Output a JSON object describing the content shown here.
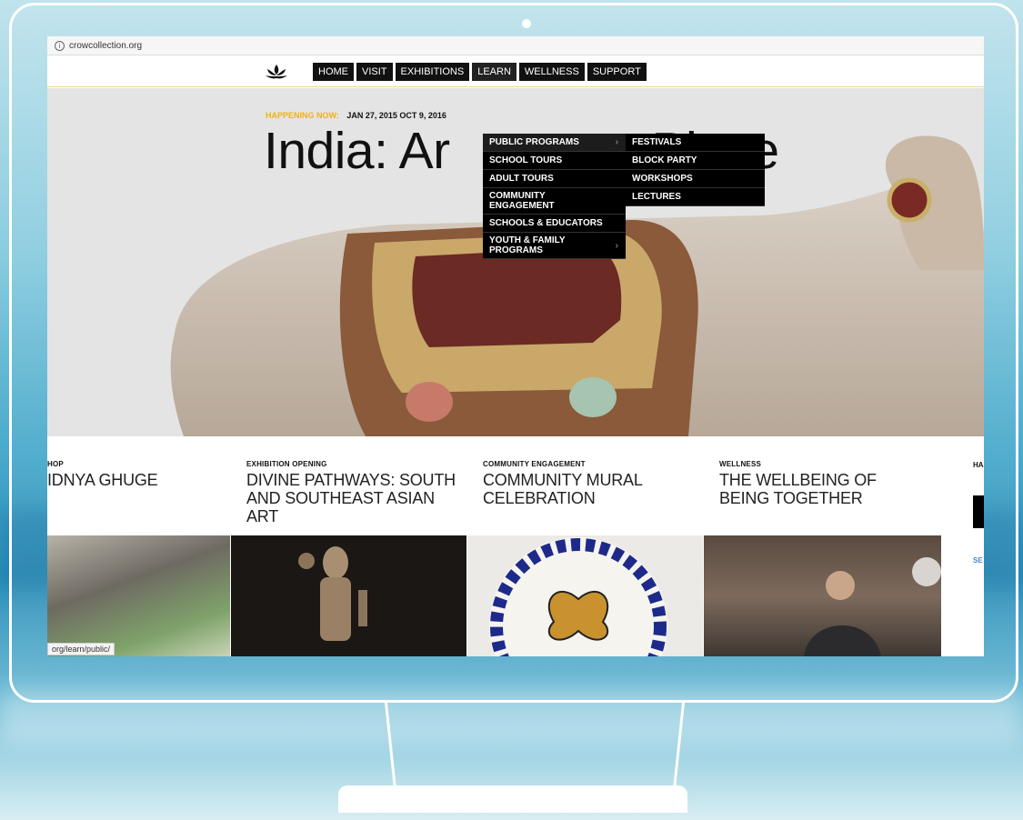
{
  "browser": {
    "url": "crowcollection.org"
  },
  "nav": {
    "items": [
      "HOME",
      "VISIT",
      "EXHIBITIONS",
      "LEARN",
      "WELLNESS",
      "SUPPORT"
    ]
  },
  "hero": {
    "happening_label": "HAPPENING NOW:",
    "dates": "JAN 27, 2015  OCT 9, 2016",
    "title": "India: Ar",
    "title_tail": "e, Place"
  },
  "learn_menu": {
    "items": [
      {
        "label": "PUBLIC PROGRAMS",
        "has_sub": true
      },
      {
        "label": "SCHOOL TOURS",
        "has_sub": false
      },
      {
        "label": "ADULT TOURS",
        "has_sub": false
      },
      {
        "label": "COMMUNITY ENGAGEMENT",
        "has_sub": false
      },
      {
        "label": "SCHOOLS & EDUCATORS",
        "has_sub": false
      },
      {
        "label": "YOUTH & FAMILY PROGRAMS",
        "has_sub": true
      }
    ],
    "submenu": [
      "FESTIVALS",
      "BLOCK PARTY",
      "WORKSHOPS",
      "LECTURES"
    ]
  },
  "cards": [
    {
      "kicker": "HOP",
      "title": "IDNYA GHUGE"
    },
    {
      "kicker": "EXHIBITION OPENING",
      "title": "DIVINE PATHWAYS: SOUTH AND SOUTHEAST ASIAN ART"
    },
    {
      "kicker": "COMMUNITY ENGAGEMENT",
      "title": "COMMUNITY MURAL CELEBRATION"
    },
    {
      "kicker": "WELLNESS",
      "title": "THE WELLBEING OF BEING TOGETHER"
    }
  ],
  "side": {
    "tab": "HA",
    "link": "SE"
  },
  "status_url": "org/learn/public/",
  "colors": {
    "accent": "#f2b600",
    "nav_bg": "#111111",
    "sky": "#49aacb"
  },
  "icons": [
    "info-icon",
    "lotus-logo-icon",
    "chevron-right-icon"
  ]
}
